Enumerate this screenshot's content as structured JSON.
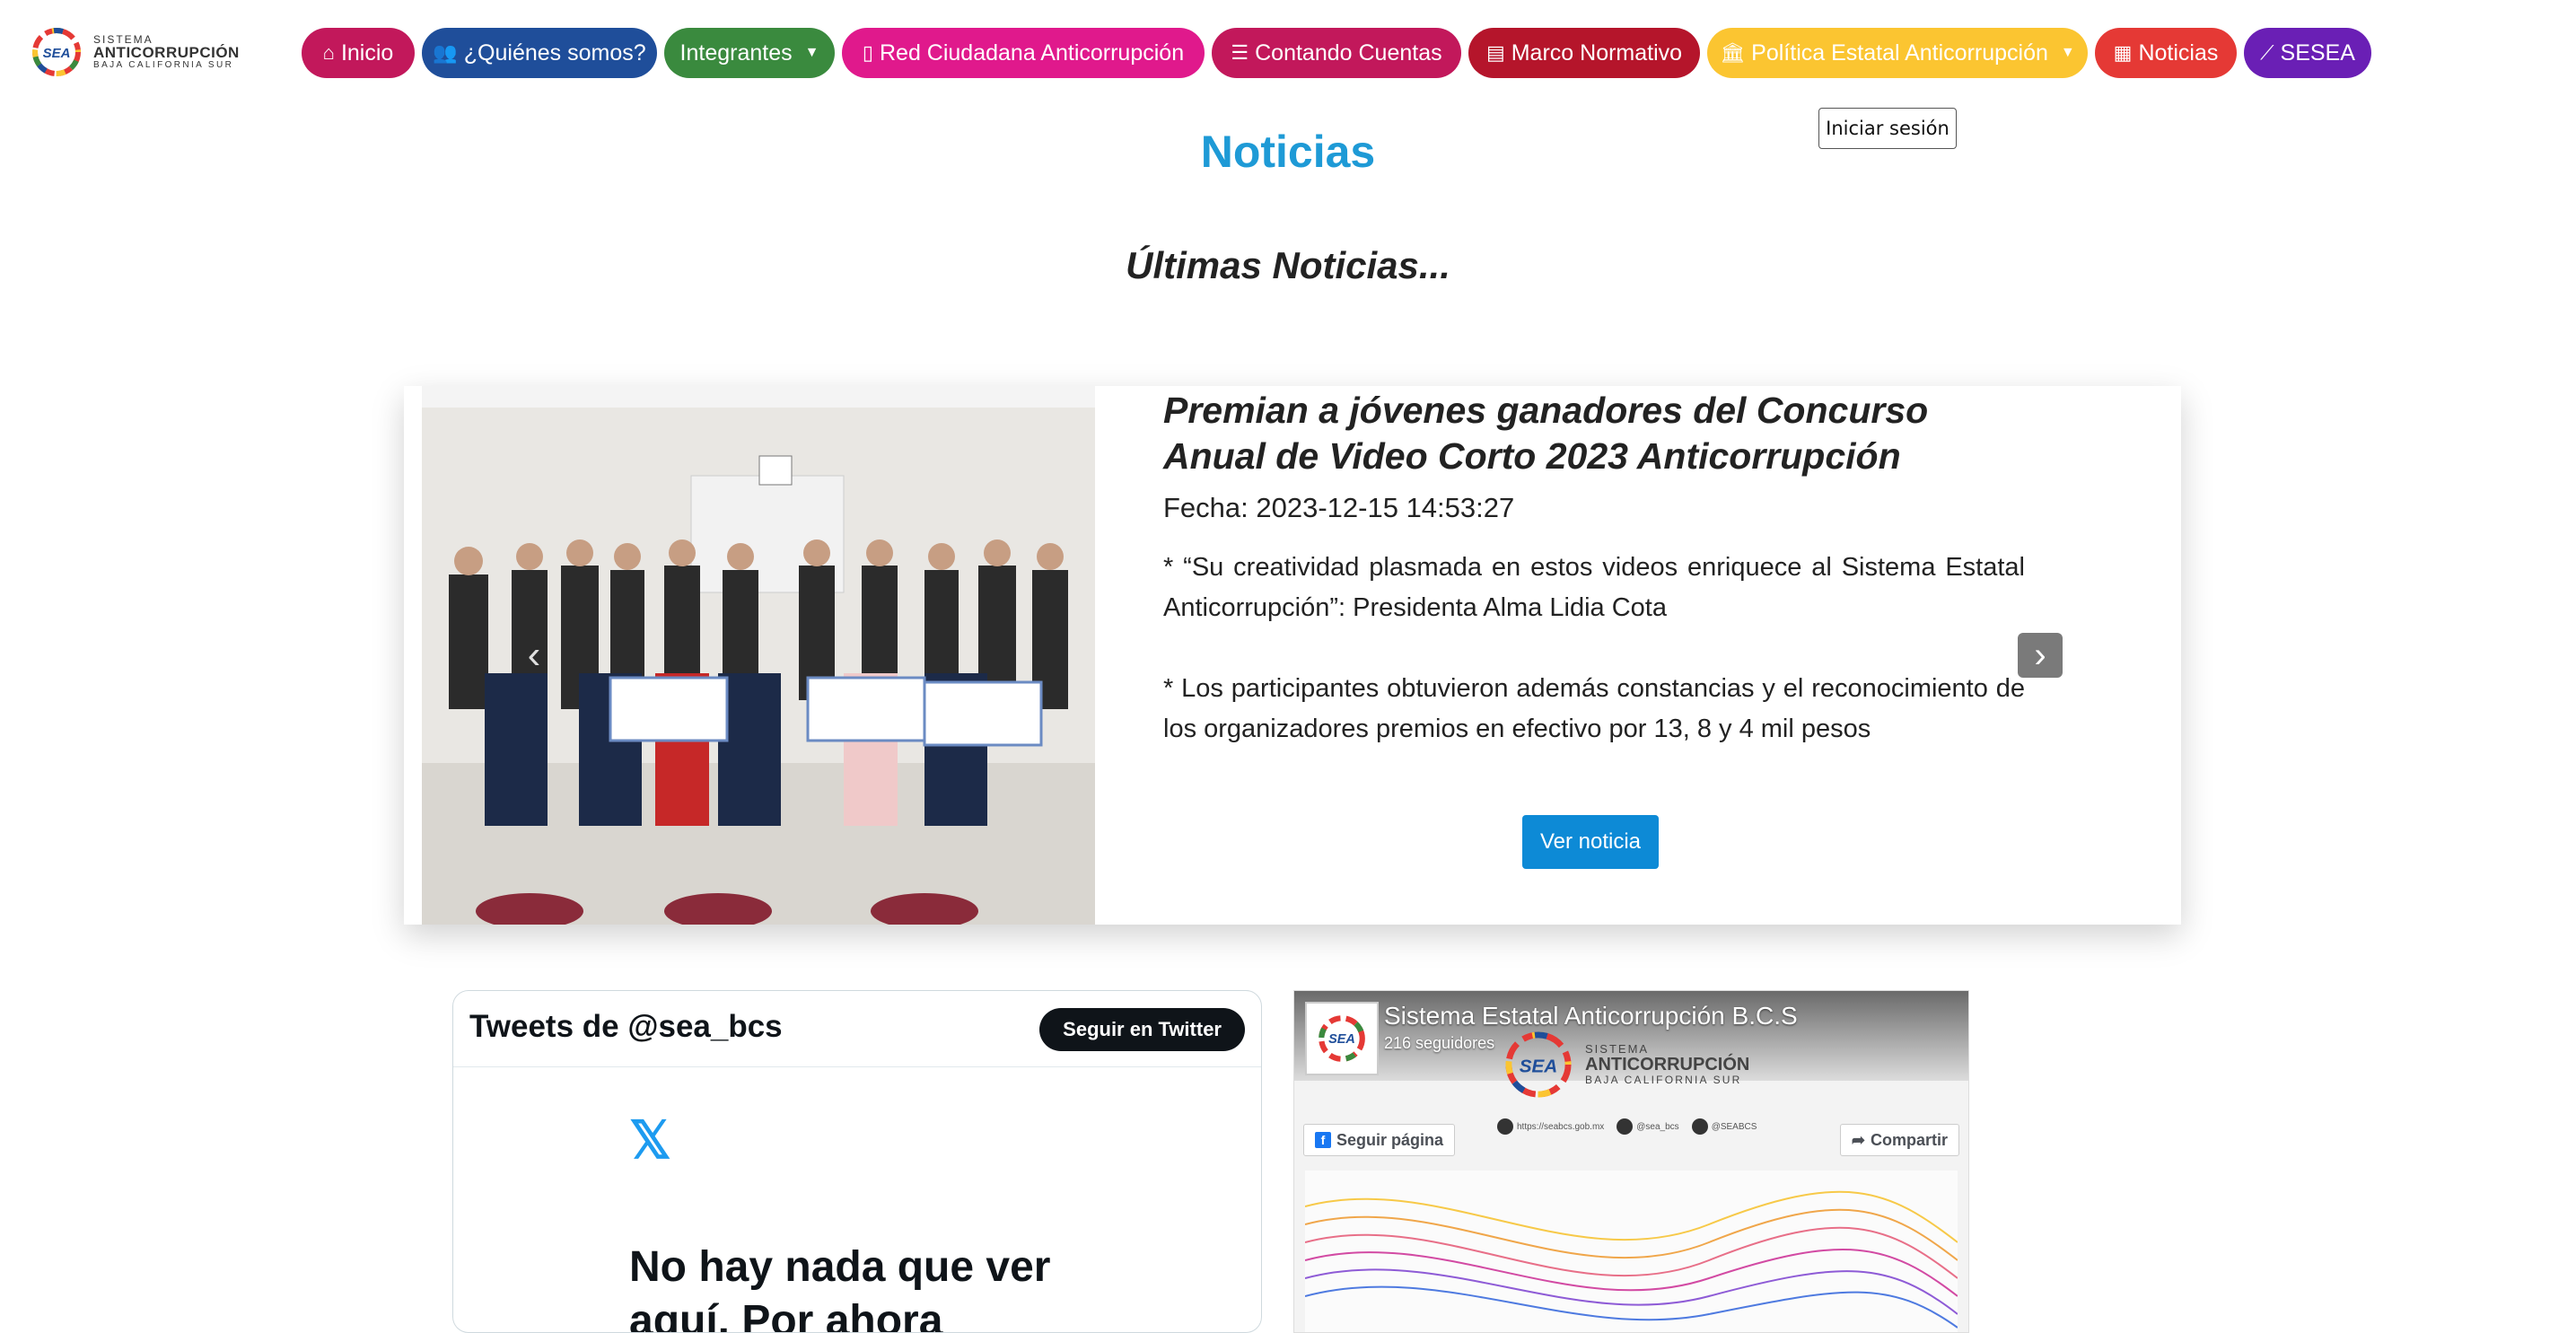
{
  "brand": {
    "logo_mark": "SEA",
    "line1": "SISTEMA",
    "line2": "ANTICORRUPCIÓN",
    "line3": "BAJA CALIFORNIA SUR"
  },
  "nav": {
    "items": [
      {
        "label": "Inicio",
        "icon": "home-icon",
        "color": "#c2185b"
      },
      {
        "label": "¿Quiénes somos?",
        "icon": "people-icon",
        "color": "#1f4e9a"
      },
      {
        "label": "Integrantes",
        "icon": "",
        "color": "#3a8a3e"
      },
      {
        "label": "Red Ciudadana Anticorrupción",
        "icon": "book-icon",
        "color": "#e0198c"
      },
      {
        "label": "Contando Cuentas",
        "icon": "list-icon",
        "color": "#c2185b"
      },
      {
        "label": "Marco Normativo",
        "icon": "document-icon",
        "color": "#b5152b"
      },
      {
        "label": "Política Estatal Anticorrupción",
        "icon": "building-icon",
        "color": "#fbc531"
      },
      {
        "label": "Noticias",
        "icon": "newspaper-icon",
        "color": "#e53935"
      },
      {
        "label": "SESEA",
        "icon": "wand-icon",
        "color": "#6a1fb5"
      }
    ],
    "login": "Iniciar sesión"
  },
  "page": {
    "title": "Noticias",
    "section": "Últimas Noticias..."
  },
  "news": {
    "title": "Premian a jóvenes ganadores del Concurso Anual de Video Corto 2023 Anticorrupción",
    "date": "Fecha: 2023-12-15 14:53:27",
    "paragraph1": "* “Su creatividad plasmada en estos videos enriquece al Sistema Estatal Anticorrupción”: Presidenta Alma Lidia Cota",
    "paragraph2": "* Los participantes obtuvieron además constancias y el reconocimiento de los organizadores premios en efectivo por 13, 8 y 4 mil pesos",
    "button": "Ver noticia"
  },
  "twitter": {
    "title": "Tweets de @sea_bcs",
    "follow": "Seguir en Twitter",
    "x_logo": "𝕏",
    "empty": "No hay nada que ver aquí. Por ahora"
  },
  "facebook": {
    "name": "Sistema Estatal Anticorrupción B.C.S",
    "followers": "216 seguidores",
    "follow": "Seguir página",
    "share": "Compartir",
    "cover_line1": "SISTEMA",
    "cover_line2": "ANTICORRUPCIÓN",
    "cover_line3": "BAJA CALIFORNIA SUR",
    "link1": "https://seabcs.gob.mx",
    "link2": "@sea_bcs",
    "link3": "@SEABCS"
  }
}
